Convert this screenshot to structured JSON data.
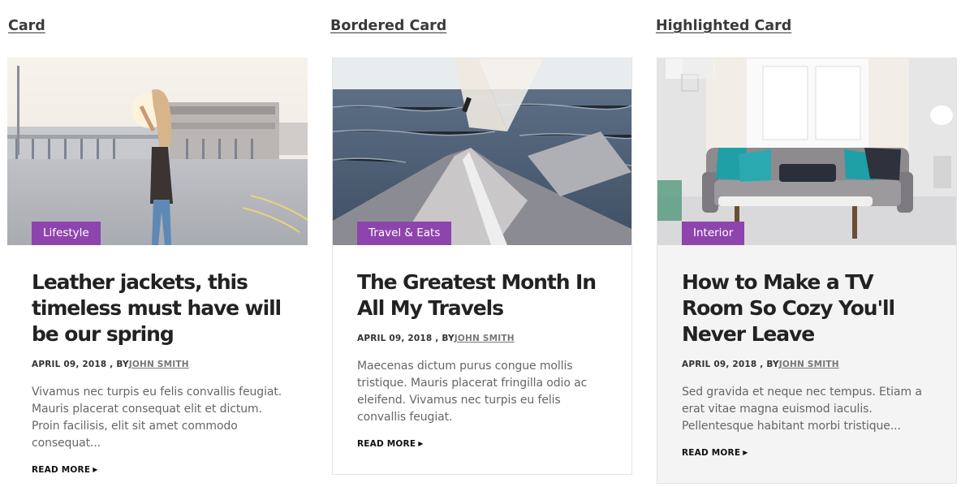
{
  "columns": [
    {
      "section_title": "Card",
      "tag": "Lifestyle",
      "headline": "Leather jackets, this timeless must have will be our spring",
      "date": "APRIL 09, 2018 , BY",
      "author": "JOHN SMITH",
      "excerpt": "Vivamus nec turpis eu felis convallis feugiat. Mauris placerat consequat elit et dictum. Proin facilisis, elit sit amet commodo consequat...",
      "read_more": "READ MORE"
    },
    {
      "section_title": "Bordered Card",
      "tag": "Travel & Eats",
      "headline": "The Greatest Month In All My Travels",
      "date": "APRIL 09, 2018 , BY",
      "author": "JOHN SMITH",
      "excerpt": "Maecenas dictum purus congue mollis tristique. Mauris placerat fringilla odio ac eleifend. Vivamus nec turpis eu felis convallis feugiat.",
      "read_more": "READ MORE"
    },
    {
      "section_title": "Highlighted Card",
      "tag": "Interior",
      "headline": "How to Make a TV Room So Cozy You'll Never Leave",
      "date": "APRIL 09, 2018 , BY",
      "author": "JOHN SMITH",
      "excerpt": "Sed gravida et neque nec tempus. Etiam a erat vitae magna euismod iaculis. Pellentesque habitant morbi tristique...",
      "read_more": "READ MORE"
    }
  ],
  "images": [
    "woman-on-rooftop-photo",
    "sailboat-on-sea-photo",
    "living-room-sofa-photo"
  ],
  "colors": {
    "tag_background": "#8e44ad",
    "highlight_background": "#f4f4f4",
    "border": "#e3e3e3"
  }
}
